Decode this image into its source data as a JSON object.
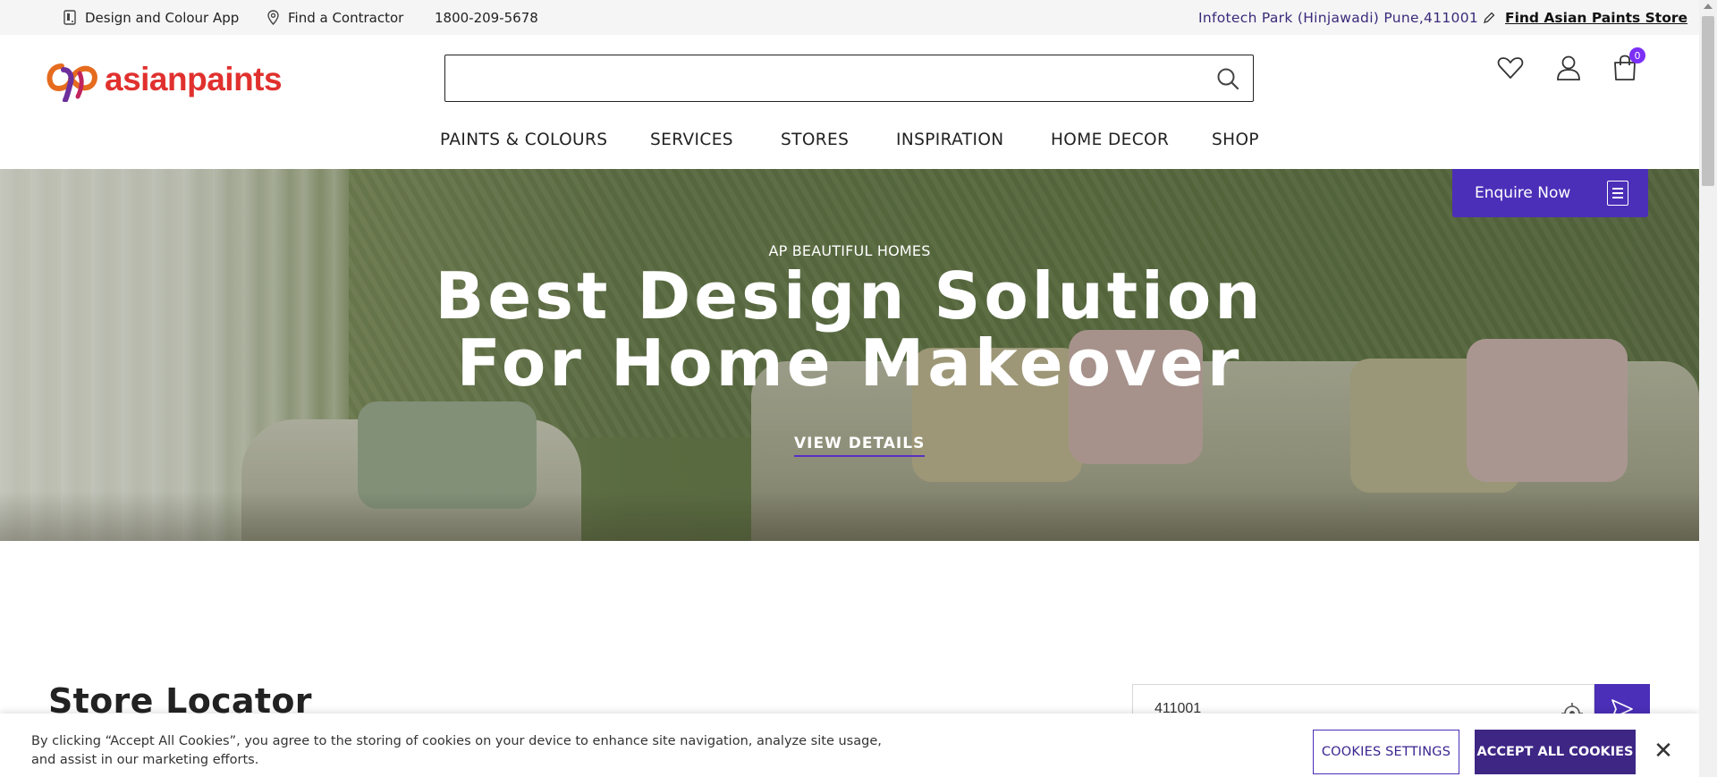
{
  "topbar": {
    "app_label": "Design and Colour App",
    "contractor_label": "Find a Contractor",
    "phone": "1800-209-5678",
    "location": "Infotech Park (Hinjawadi) Pune,411001",
    "store_link": "Find Asian Paints Store"
  },
  "header": {
    "logo_text": "asianpaints",
    "search_value": "",
    "cart_count": "0"
  },
  "nav": {
    "items": [
      "PAINTS & COLOURS",
      "SERVICES",
      "STORES",
      "INSPIRATION",
      "HOME DECOR",
      "SHOP"
    ]
  },
  "hero": {
    "kicker": "AP BEAUTIFUL HOMES",
    "title_line1": "Best Design Solution",
    "title_line2": "For Home Makeover",
    "cta": "VIEW DETAILS",
    "enquire": "Enquire Now"
  },
  "locator": {
    "title": "Store Locator",
    "pincode": "411001"
  },
  "cookie": {
    "text": "By clicking “Accept All Cookies”, you agree to the storing of cookies on your device to enhance site navigation, analyze site usage, and assist in our marketing efforts.",
    "settings": "COOKIES SETTINGS",
    "accept": "ACCEPT ALL COOKIES",
    "close": "✕"
  },
  "colors": {
    "brand_purple": "#4b2fb8",
    "brand_red": "#e0312e",
    "badge": "#7b2ff7"
  }
}
